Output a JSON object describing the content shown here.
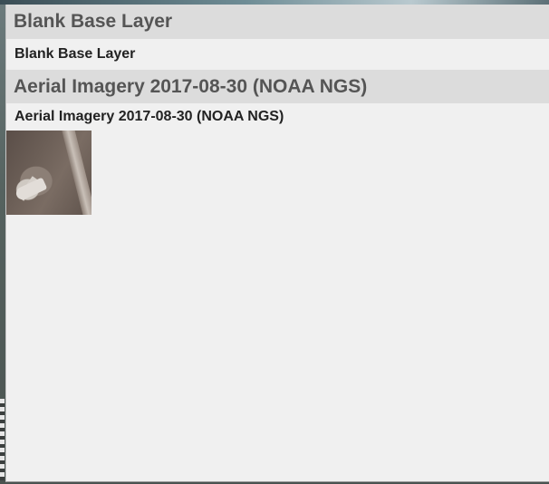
{
  "layer_panel": {
    "groups": [
      {
        "header": "Blank Base Layer",
        "option_label": "Blank Base Layer"
      },
      {
        "header": "Aerial Imagery 2017-08-30 (NOAA NGS)",
        "option_label": "Aerial Imagery 2017-08-30 (NOAA NGS)",
        "thumbnail_icon": "aerial-imagery-thumbnail"
      }
    ]
  },
  "colors": {
    "panel_background": "#f0f0f0",
    "header_background": "#dcdcdc",
    "header_text": "#555555",
    "option_text": "#222222"
  }
}
